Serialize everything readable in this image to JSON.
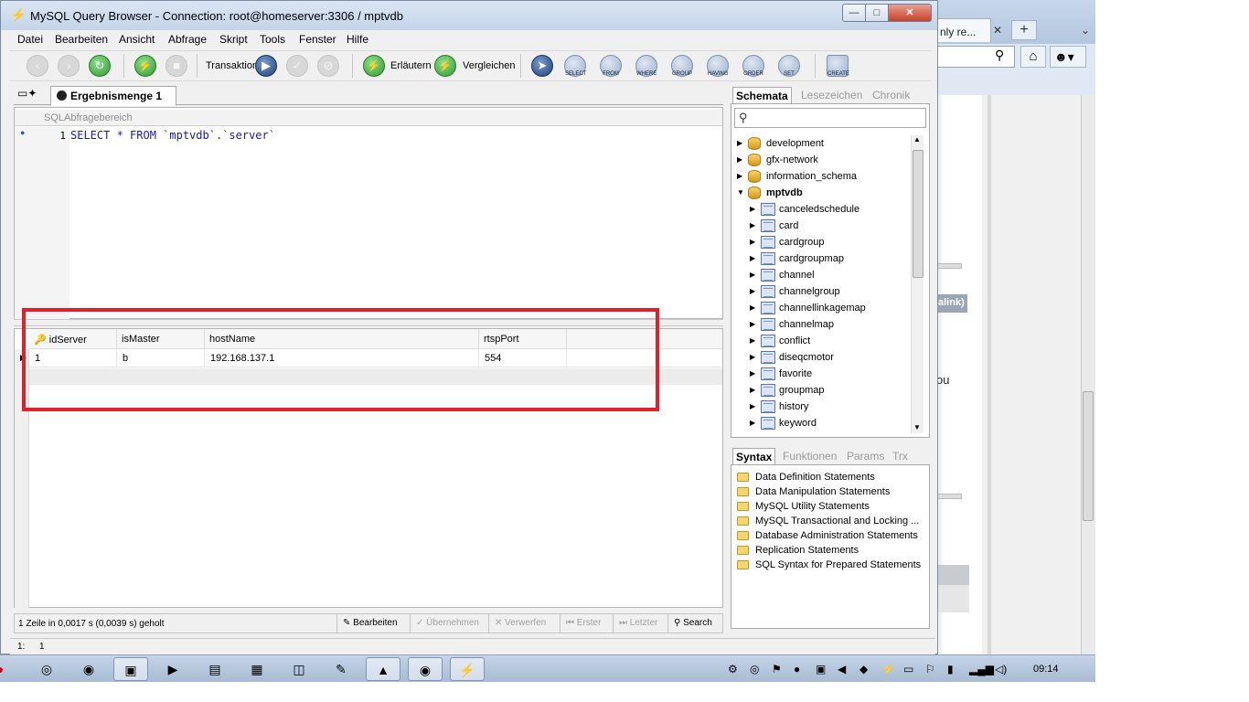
{
  "window": {
    "title": "MySQL Query Browser - Connection: root@homeserver:3306 / mptvdb",
    "minimize": "—",
    "maximize": "□",
    "close": "✕"
  },
  "menu": [
    "Datei",
    "Bearbeiten",
    "Ansicht",
    "Abfrage",
    "Skript",
    "Tools",
    "Fenster",
    "Hilfe"
  ],
  "toolbar": {
    "transaction_label": "Transaktion",
    "explain_label": "Erläutern",
    "compare_label": "Vergleichen",
    "keywords": [
      "SELECT",
      "FROM",
      "WHERE",
      "GROUP",
      "HAVING",
      "ORDER",
      "SET"
    ],
    "create_label": "CREATE"
  },
  "left_tab": {
    "label": "Ergebnismenge 1"
  },
  "editor": {
    "header": "SQLAbfragebereich",
    "line_number": "1",
    "code": "SELECT * FROM `mptvdb`.`server`"
  },
  "results": {
    "columns": [
      "idServer",
      "isMaster",
      "hostName",
      "rtspPort"
    ],
    "rows": [
      [
        "1",
        "b",
        "192.168.137.1",
        "554"
      ]
    ]
  },
  "status": {
    "text": "1 Zeile in 0,0017 s (0,0039 s) geholt",
    "edit": "Bearbeiten",
    "apply": "Übernehmen",
    "discard": "Verwerfen",
    "first": "Erster",
    "last": "Letzter",
    "search": "Search"
  },
  "schema_tabs": [
    "Schemata",
    "Lesezeichen",
    "Chronik"
  ],
  "databases": [
    "development",
    "gfx-network",
    "information_schema",
    "mptvdb"
  ],
  "tables": [
    "canceledschedule",
    "card",
    "cardgroup",
    "cardgroupmap",
    "channel",
    "channelgroup",
    "channellinkagemap",
    "channelmap",
    "conflict",
    "diseqcmotor",
    "favorite",
    "groupmap",
    "history",
    "keyword"
  ],
  "syntax_tabs": [
    "Syntax",
    "Funktionen",
    "Params",
    "Trx"
  ],
  "syntax_items": [
    "Data Definition Statements",
    "Data Manipulation Statements",
    "MySQL Utility Statements",
    "MySQL Transactional and Locking ...",
    "Database Administration Statements",
    "Replication Statements",
    "SQL Syntax for Prepared Statements"
  ],
  "bottom_status": {
    "pos_line": "1:",
    "pos_col": "1"
  },
  "browser": {
    "tab_label": "nly re...",
    "tab_close": "✕",
    "new_tab": "+",
    "link_fragment": "alink)",
    "text_fragment": "ou"
  },
  "taskbar": {
    "clock": "09:14"
  },
  "colors": {
    "highlight": "#e0202a",
    "sql_keyword": "#1a1ab0"
  }
}
